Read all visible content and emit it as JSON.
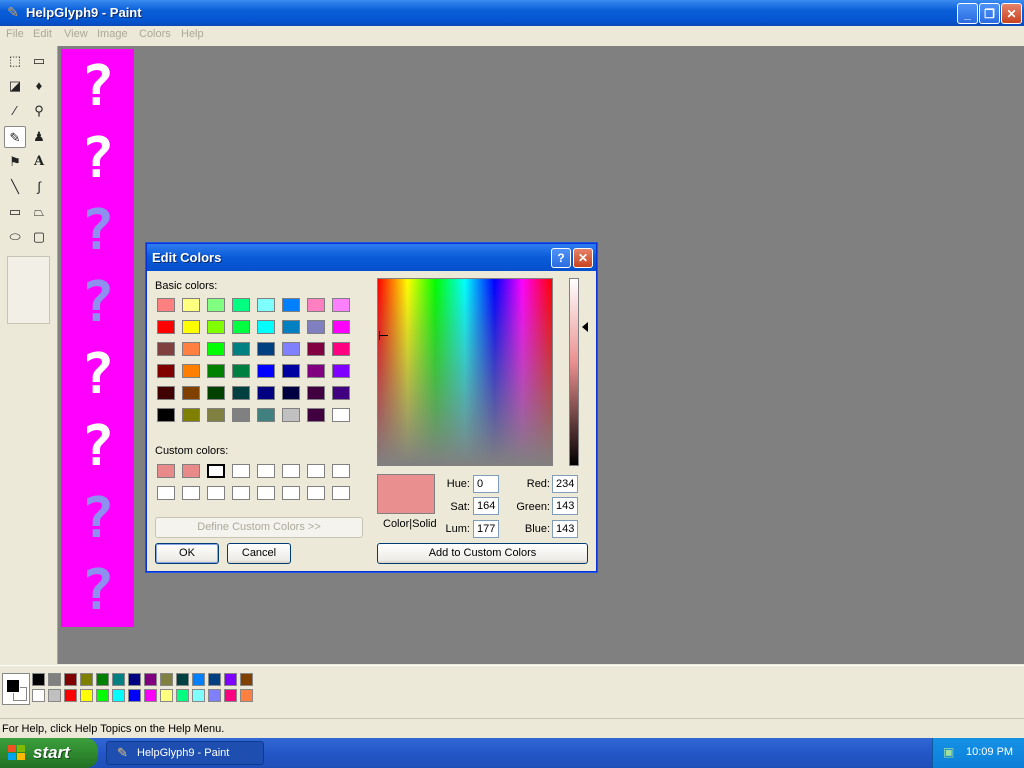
{
  "window": {
    "title": "HelpGlyph9 - Paint"
  },
  "menu": [
    "File",
    "Edit",
    "View",
    "Image",
    "Colors",
    "Help"
  ],
  "tools": [
    "free-form-select",
    "select",
    "eraser",
    "fill-with-color",
    "pick-color",
    "magnifier",
    "pencil",
    "brush",
    "airbrush",
    "text",
    "line",
    "curve",
    "rectangle",
    "polygon",
    "ellipse",
    "rounded-rectangle"
  ],
  "canvas": {
    "background": "#ff00ff",
    "glyph": "?",
    "glyph_colors": [
      "#ffffff",
      "#ffffff",
      "#8f8fef",
      "#8f8fef",
      "#ffffff",
      "#ffffff",
      "#8f8fef",
      "#8f8fef"
    ]
  },
  "palette": {
    "row1": [
      "#000000",
      "#808080",
      "#800000",
      "#808000",
      "#008000",
      "#008080",
      "#000080",
      "#800080",
      "#808040",
      "#004040",
      "#0080ff",
      "#004080",
      "#8000ff",
      "#804000"
    ],
    "row2": [
      "#ffffff",
      "#c0c0c0",
      "#ff0000",
      "#ffff00",
      "#00ff00",
      "#00ffff",
      "#0000ff",
      "#ff00ff",
      "#ffff80",
      "#00ff80",
      "#80ffff",
      "#8080ff",
      "#ff0080",
      "#ff8040"
    ],
    "foreground": "#000000",
    "background": "#ffffff"
  },
  "status": {
    "text": "For Help, click Help Topics on the Help Menu."
  },
  "taskbar": {
    "start": "start",
    "task": "HelpGlyph9 - Paint",
    "clock": "10:09 PM"
  },
  "dialog": {
    "title": "Edit Colors",
    "help": "?",
    "close": "✕",
    "basic_label": "Basic colors:",
    "custom_label": "Custom colors:",
    "basic_colors": [
      [
        "#ff8080",
        "#ffff80",
        "#80ff80",
        "#00ff80",
        "#80ffff",
        "#0080ff",
        "#ff80c0",
        "#ff80ff"
      ],
      [
        "#ff0000",
        "#ffff00",
        "#80ff00",
        "#00ff40",
        "#00ffff",
        "#0080c0",
        "#8080c0",
        "#ff00ff"
      ],
      [
        "#804040",
        "#ff8040",
        "#00ff00",
        "#008080",
        "#004080",
        "#8080ff",
        "#800040",
        "#ff0080"
      ],
      [
        "#800000",
        "#ff8000",
        "#008000",
        "#008040",
        "#0000ff",
        "#0000a0",
        "#800080",
        "#8000ff"
      ],
      [
        "#400000",
        "#804000",
        "#004000",
        "#004040",
        "#000080",
        "#000040",
        "#400040",
        "#400080"
      ],
      [
        "#000000",
        "#808000",
        "#808040",
        "#808080",
        "#408080",
        "#c0c0c0",
        "#400040",
        "#ffffff"
      ]
    ],
    "custom_colors": [
      [
        "#e88a8a",
        "#e88a8a",
        "#ffffff",
        "#ffffff",
        "#ffffff",
        "#ffffff",
        "#ffffff",
        "#ffffff"
      ],
      [
        "#ffffff",
        "#ffffff",
        "#ffffff",
        "#ffffff",
        "#ffffff",
        "#ffffff",
        "#ffffff",
        "#ffffff"
      ]
    ],
    "define_custom": "Define Custom Colors >>",
    "ok": "OK",
    "cancel": "Cancel",
    "add_custom": "Add to Custom Colors",
    "color_solid_label": "Color|Solid",
    "preview_color": "#ea8f8f",
    "hue_label": "Hue:",
    "hue": "0",
    "sat_label": "Sat:",
    "sat": "164",
    "lum_label": "Lum:",
    "lum": "177",
    "red_label": "Red:",
    "red": "234",
    "green_label": "Green:",
    "green": "143",
    "blue_label": "Blue:",
    "blue": "143"
  }
}
